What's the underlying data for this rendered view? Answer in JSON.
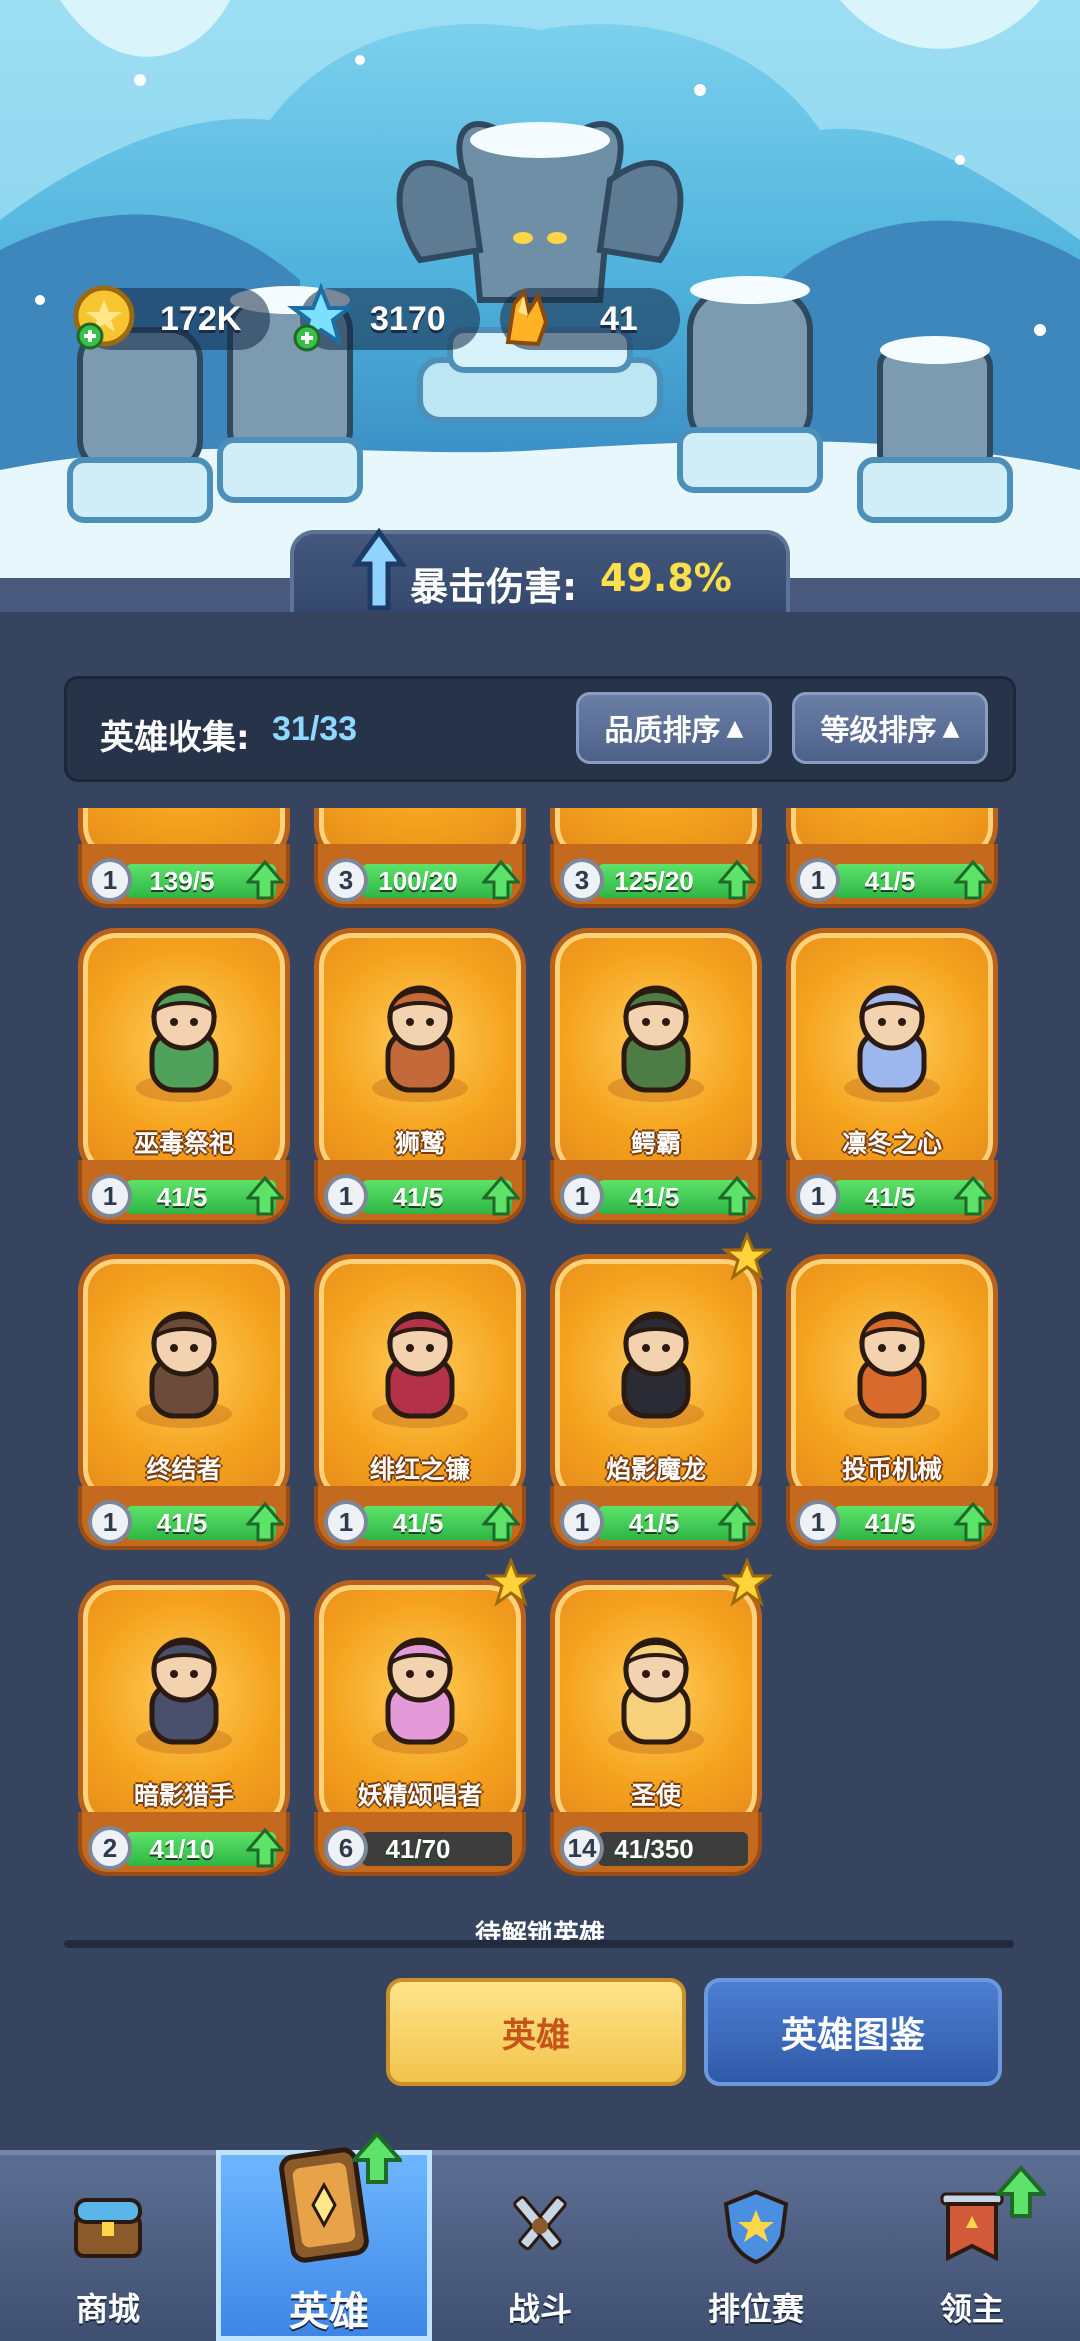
{
  "resources": [
    {
      "icon": "gold-coin-icon",
      "value": "172K"
    },
    {
      "icon": "blue-gem-icon",
      "value": "3170"
    },
    {
      "icon": "amber-crystal-icon",
      "value": "41"
    }
  ],
  "buff": {
    "label": "暴击伤害:",
    "value": "49.8%"
  },
  "collection": {
    "label": "英雄收集:",
    "count": "31/33",
    "sort_quality": "品质排序",
    "sort_level": "等级排序"
  },
  "partial_row": [
    {
      "level": "1",
      "progress": "139/5",
      "full": true
    },
    {
      "level": "3",
      "progress": "100/20",
      "full": true
    },
    {
      "level": "3",
      "progress": "125/20",
      "full": true
    },
    {
      "level": "1",
      "progress": "41/5",
      "full": true
    }
  ],
  "heroes": [
    {
      "name": "巫毒祭祀",
      "level": "1",
      "progress": "41/5",
      "full": true,
      "star": false
    },
    {
      "name": "狮鹫",
      "level": "1",
      "progress": "41/5",
      "full": true,
      "star": false
    },
    {
      "name": "鳄霸",
      "level": "1",
      "progress": "41/5",
      "full": true,
      "star": false
    },
    {
      "name": "凛冬之心",
      "level": "1",
      "progress": "41/5",
      "full": true,
      "star": false
    },
    {
      "name": "终结者",
      "level": "1",
      "progress": "41/5",
      "full": true,
      "star": false
    },
    {
      "name": "绯红之镰",
      "level": "1",
      "progress": "41/5",
      "full": true,
      "star": false
    },
    {
      "name": "焰影魔龙",
      "level": "1",
      "progress": "41/5",
      "full": true,
      "star": true
    },
    {
      "name": "投币机械",
      "level": "1",
      "progress": "41/5",
      "full": true,
      "star": false
    },
    {
      "name": "暗影猎手",
      "level": "2",
      "progress": "41/10",
      "full": true,
      "star": false
    },
    {
      "name": "妖精颂唱者",
      "level": "6",
      "progress": "41/70",
      "full": false,
      "star": true
    },
    {
      "name": "圣使",
      "level": "14",
      "progress": "41/350",
      "full": false,
      "star": true
    }
  ],
  "locked_label": "待解锁英雄",
  "buttons": {
    "hero": "英雄",
    "dex": "英雄图鉴"
  },
  "nav": [
    {
      "label": "商城",
      "icon": "shop-chest-icon",
      "active": false
    },
    {
      "label": "英雄",
      "icon": "hero-card-icon",
      "active": true
    },
    {
      "label": "战斗",
      "icon": "crossed-swords-icon",
      "active": false
    },
    {
      "label": "排位赛",
      "icon": "rank-shield-icon",
      "active": false
    },
    {
      "label": "领主",
      "icon": "lord-banner-icon",
      "active": false
    }
  ],
  "colors": {
    "accent_gold": "#ffe04a",
    "progress_green": "#2fb545",
    "card_orange": "#f5a31e",
    "panel": "#36445f"
  }
}
